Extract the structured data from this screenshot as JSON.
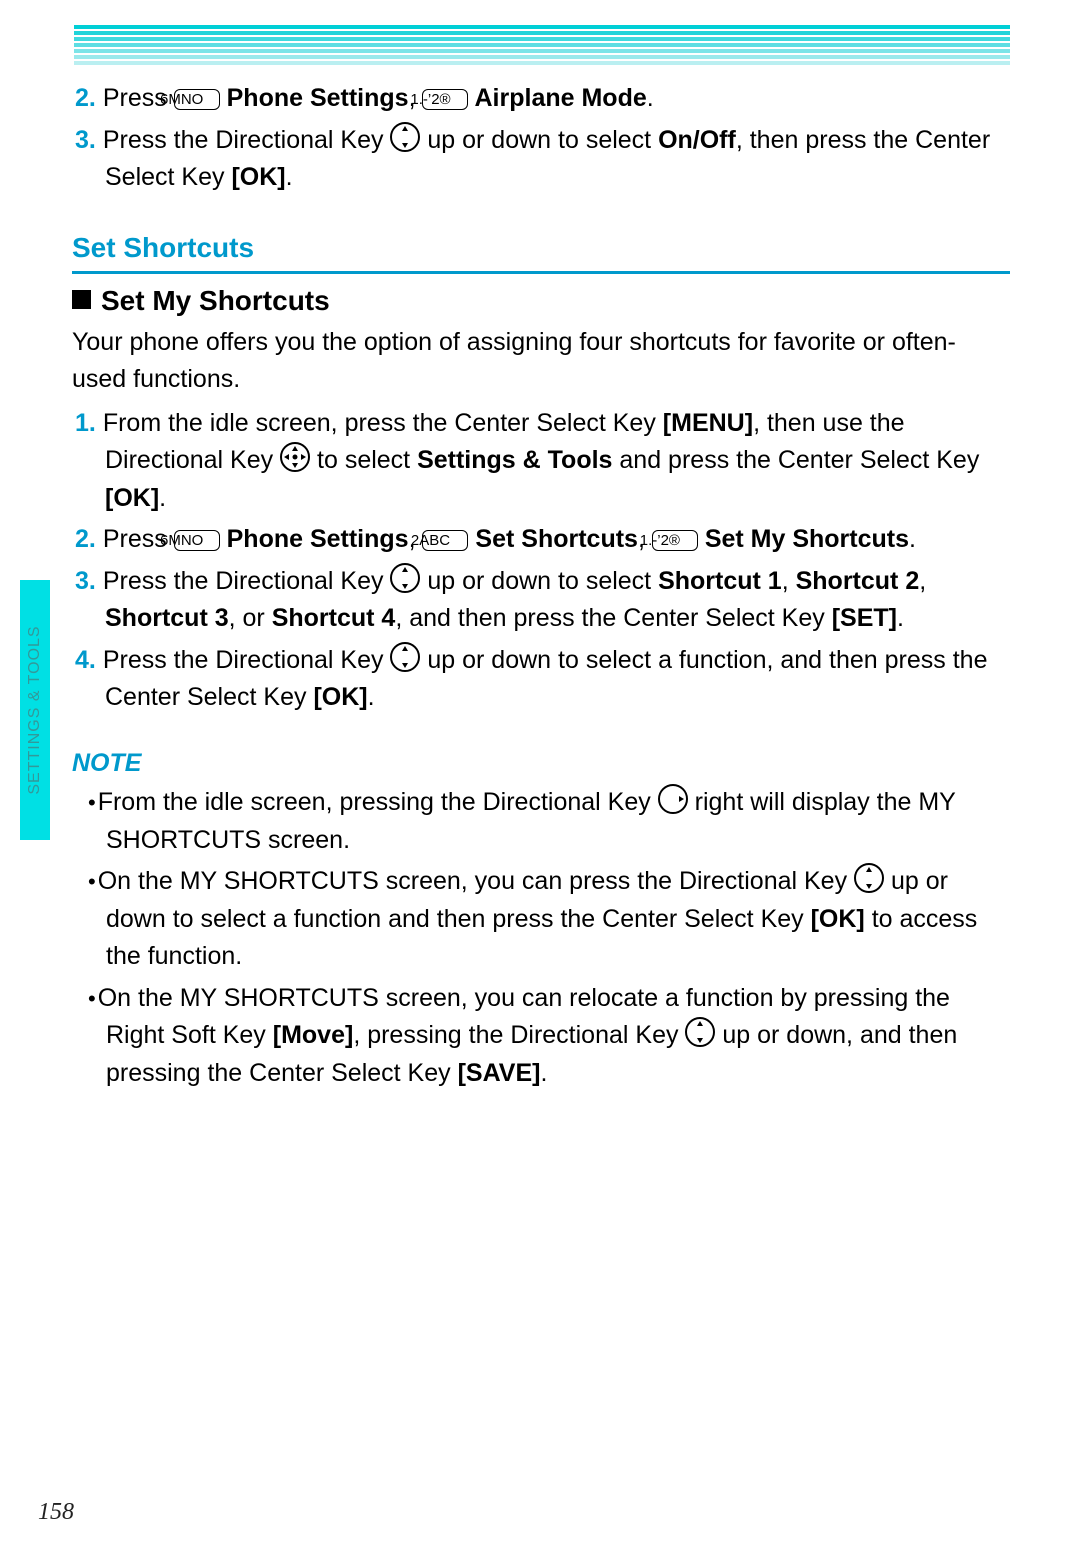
{
  "page_number": "158",
  "side_tab": "SETTINGS & TOOLS",
  "section_a": {
    "step2": {
      "num": "2.",
      "t1": "Press ",
      "key6": "6MNO",
      "b1": " Phone Settings",
      "t2": ", ",
      "key1": "1.-’2®",
      "b2": " Airplane Mode",
      "t3": "."
    },
    "step3": {
      "num": "3.",
      "t1": "Press the Directional Key ",
      "t2": " up or down to select ",
      "b1": "On/Off",
      "t3": ", then press the Center Select Key ",
      "b2": "[OK]",
      "t4": "."
    }
  },
  "heading_set_shortcuts": "Set Shortcuts",
  "subheading_set_my": "Set My Shortcuts",
  "intro_body": "Your phone offers you the option of assigning four shortcuts for favorite or often-used functions.",
  "list_b": {
    "step1": {
      "num": "1.",
      "t1": "From the idle screen, press the Center Select Key ",
      "b1": "[MENU]",
      "t2": ", then use the Directional Key ",
      "t3": " to select ",
      "b2": "Settings & Tools",
      "t4": " and press the Center Select Key ",
      "b3": "[OK]",
      "t5": "."
    },
    "step2": {
      "num": "2.",
      "t1": "Press ",
      "key6": "6MNO",
      "b1": " Phone Settings",
      "t2": ", ",
      "key2": "2ABC",
      "b2": " Set Shortcuts",
      "t3": ", ",
      "key1": "1.-’2®",
      "b3": " Set My Shortcuts",
      "t4": "."
    },
    "step3": {
      "num": "3.",
      "t1": "Press the Directional Key ",
      "t2": " up or down to select ",
      "b1": "Shortcut 1",
      "t3": ", ",
      "b2": "Shortcut 2",
      "t4": ", ",
      "b3": "Shortcut 3",
      "t5": ", or ",
      "b4": "Shortcut 4",
      "t6": ", and then press the Center Select Key ",
      "b5": "[SET]",
      "t7": "."
    },
    "step4": {
      "num": "4.",
      "t1": "Press the Directional Key ",
      "t2": " up or down to select a function, and then press the Center Select Key ",
      "b1": "[OK]",
      "t3": "."
    }
  },
  "note_heading": "NOTE",
  "notes": {
    "n1": {
      "t1": "From the idle screen, pressing the Directional Key ",
      "t2": " right will display the MY SHORTCUTS screen."
    },
    "n2": {
      "t1": "On the MY SHORTCUTS screen, you can press the Directional Key ",
      "t2": " up or down to select a function and then press the Center Select Key ",
      "b1": "[OK]",
      "t3": " to access the function."
    },
    "n3": {
      "t1": "On the MY SHORTCUTS screen, you can relocate a function by pressing the Right Soft Key ",
      "b1": "[Move]",
      "t2": ", pressing the Directional Key ",
      "t3": " up or down, and then pressing the Center Select Key ",
      "b2": "[SAVE]",
      "t4": "."
    }
  },
  "stripe_colors": [
    "#00cfd6",
    "#1ad4db",
    "#37d9df",
    "#55dee3",
    "#73e3e7",
    "#91e9eb"
  ]
}
